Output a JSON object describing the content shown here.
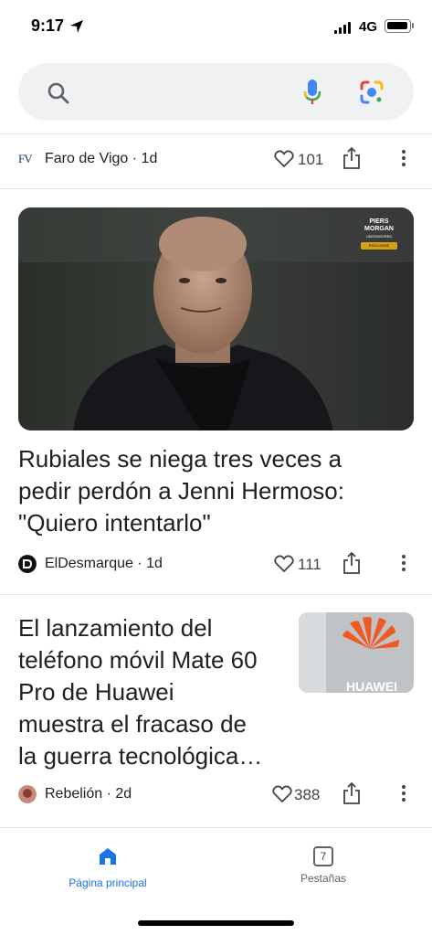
{
  "status_bar": {
    "time": "9:17",
    "network": "4G"
  },
  "search": {
    "placeholder": ""
  },
  "articles": [
    {
      "source": "Faro de Vigo",
      "source_logo_text": "FV",
      "age": "1d",
      "source_line": "Faro de Vigo · 1d",
      "likes": "101"
    },
    {
      "headline_lines": [
        "Rubiales se niega tres veces a",
        "pedir perdón a Jenni Hermoso:",
        "\"Quiero intentarlo\""
      ],
      "source_line": "ElDesmarque · 1d",
      "likes": "111",
      "image_badge_lines": [
        "PIERS",
        "MORGAN",
        "UNCENSORED",
        "EXCLUSIVE"
      ]
    },
    {
      "headline_lines": [
        "El lanzamiento del",
        "teléfono móvil Mate 60",
        "Pro de Huawei",
        "muestra el fracaso de",
        "la guerra tecnológica…"
      ],
      "source_line": "Rebelión · 2d",
      "likes": "388",
      "thumb_text": "HUAWEI"
    }
  ],
  "bottom_nav": {
    "home_label": "Página principal",
    "tabs_label": "Pestañas",
    "tabs_count": "7"
  },
  "colors": {
    "accent": "#1a73e8",
    "text": "#1f1f1f",
    "muted": "#444444"
  }
}
